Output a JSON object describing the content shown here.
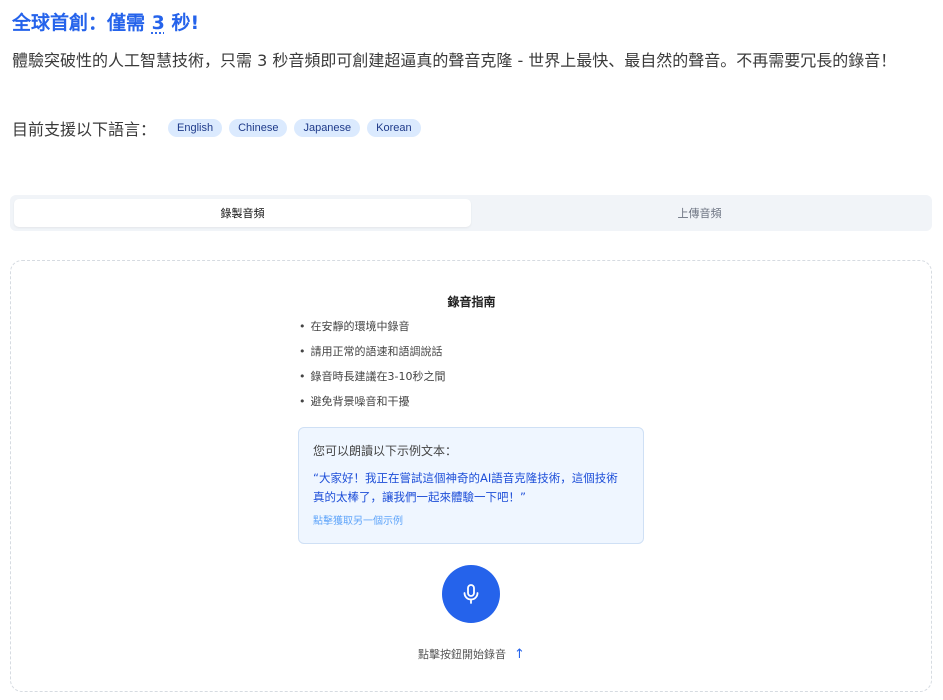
{
  "header": {
    "title_prefix": "全球首創：僅需 ",
    "title_number": "3",
    "title_suffix": " 秒!",
    "description": "體驗突破性的人工智慧技術，只需 3 秒音頻即可創建超逼真的聲音克隆 - 世界上最快、最自然的聲音。不再需要冗長的錄音！",
    "languages_label": "目前支援以下語言：",
    "languages": [
      "English",
      "Chinese",
      "Japanese",
      "Korean"
    ]
  },
  "tabs": {
    "record": "錄製音頻",
    "upload": "上傳音頻",
    "active": "record"
  },
  "guide": {
    "title": "錄音指南",
    "bullet": "•",
    "items": [
      "在安靜的環境中錄音",
      "請用正常的語速和語調說話",
      "錄音時長建議在3-10秒之間",
      "避免背景噪音和干擾"
    ]
  },
  "sample": {
    "prompt": "您可以朗讀以下示例文本：",
    "text": "“大家好！我正在嘗試這個神奇的AI語音克隆技術，這個技術真的太棒了，讓我們一起來體驗一下吧！”",
    "refresh_link": "點擊獲取另一個示例"
  },
  "record": {
    "mic_icon": "microphone-icon",
    "hint": "點擊按鈕開始錄音",
    "hint_arrow": "↑"
  },
  "colors": {
    "accent": "#2563eb",
    "badge_bg": "#dbeafe",
    "sample_bg": "#eff6ff"
  }
}
